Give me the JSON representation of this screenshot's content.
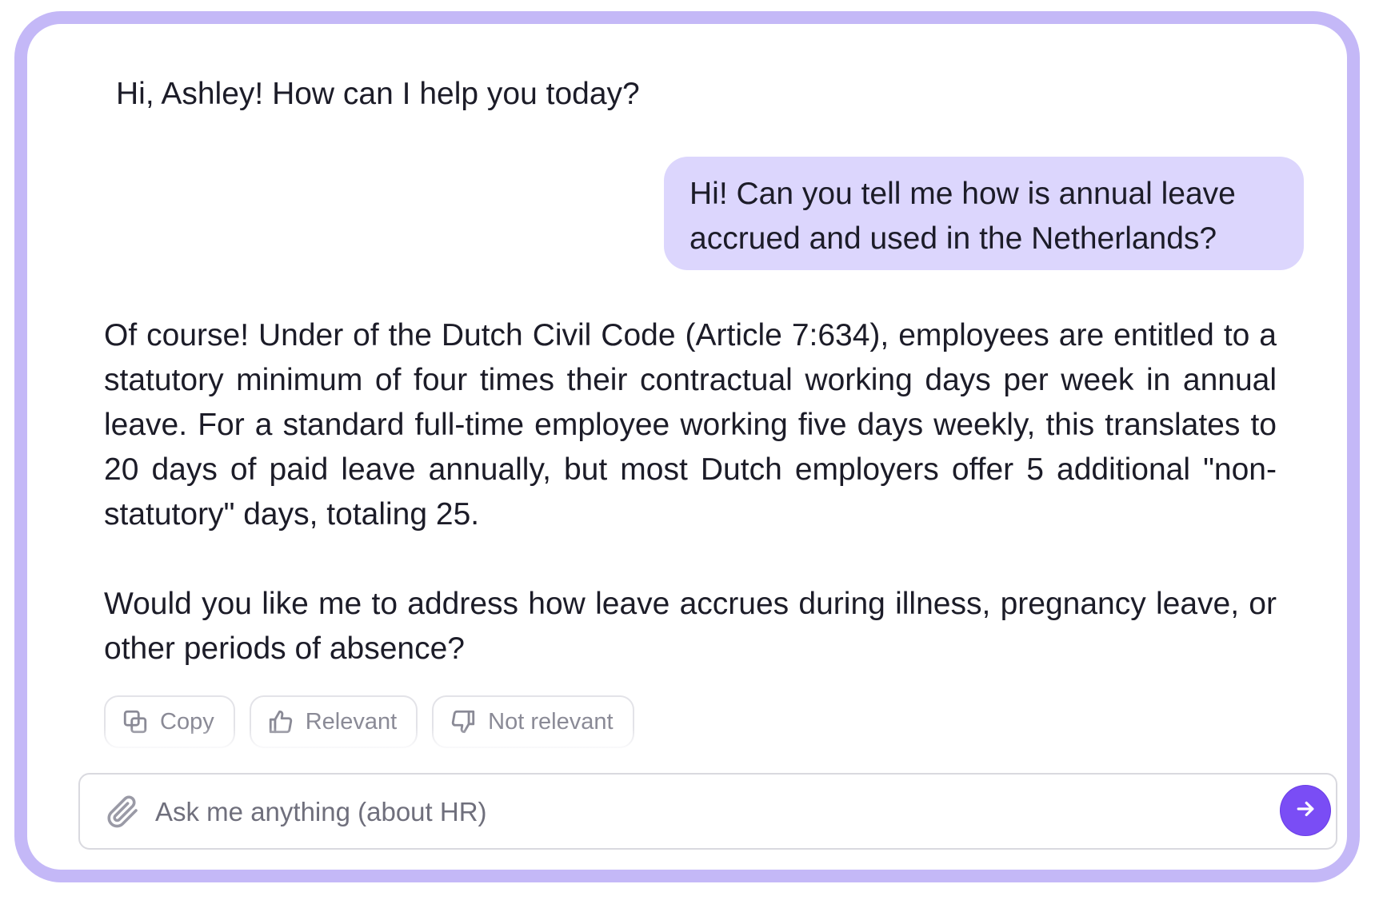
{
  "chat": {
    "greeting": "Hi, Ashley! How can I help you today?",
    "user_message": "Hi! Can you tell me how is annual leave accrued and used in the Netherlands?",
    "assistant_message": {
      "paragraph_1": "Of course! Under of the Dutch Civil Code (Article 7:634), employees are entitled to a statutory minimum of four times their contractual working days per week in annual leave. For a standard full-time employee working five days weekly, this translates to 20 days of paid leave annually, but most Dutch employers offer 5 additional \"non-statutory\" days, totaling 25.",
      "paragraph_2": "Would you like me to address how leave accrues during illness, pregnancy leave, or other periods of absence?"
    },
    "actions": {
      "copy": "Copy",
      "relevant": "Relevant",
      "not_relevant": "Not relevant"
    }
  },
  "composer": {
    "placeholder": "Ask me anything (about HR)",
    "value": "",
    "attach_icon": "paperclip-icon",
    "send_icon": "arrow-right-icon"
  },
  "colors": {
    "frame_border": "#c4b8f7",
    "user_bubble": "#dcd6fd",
    "send_button": "#7a4df5",
    "action_text": "#8a8a96"
  }
}
